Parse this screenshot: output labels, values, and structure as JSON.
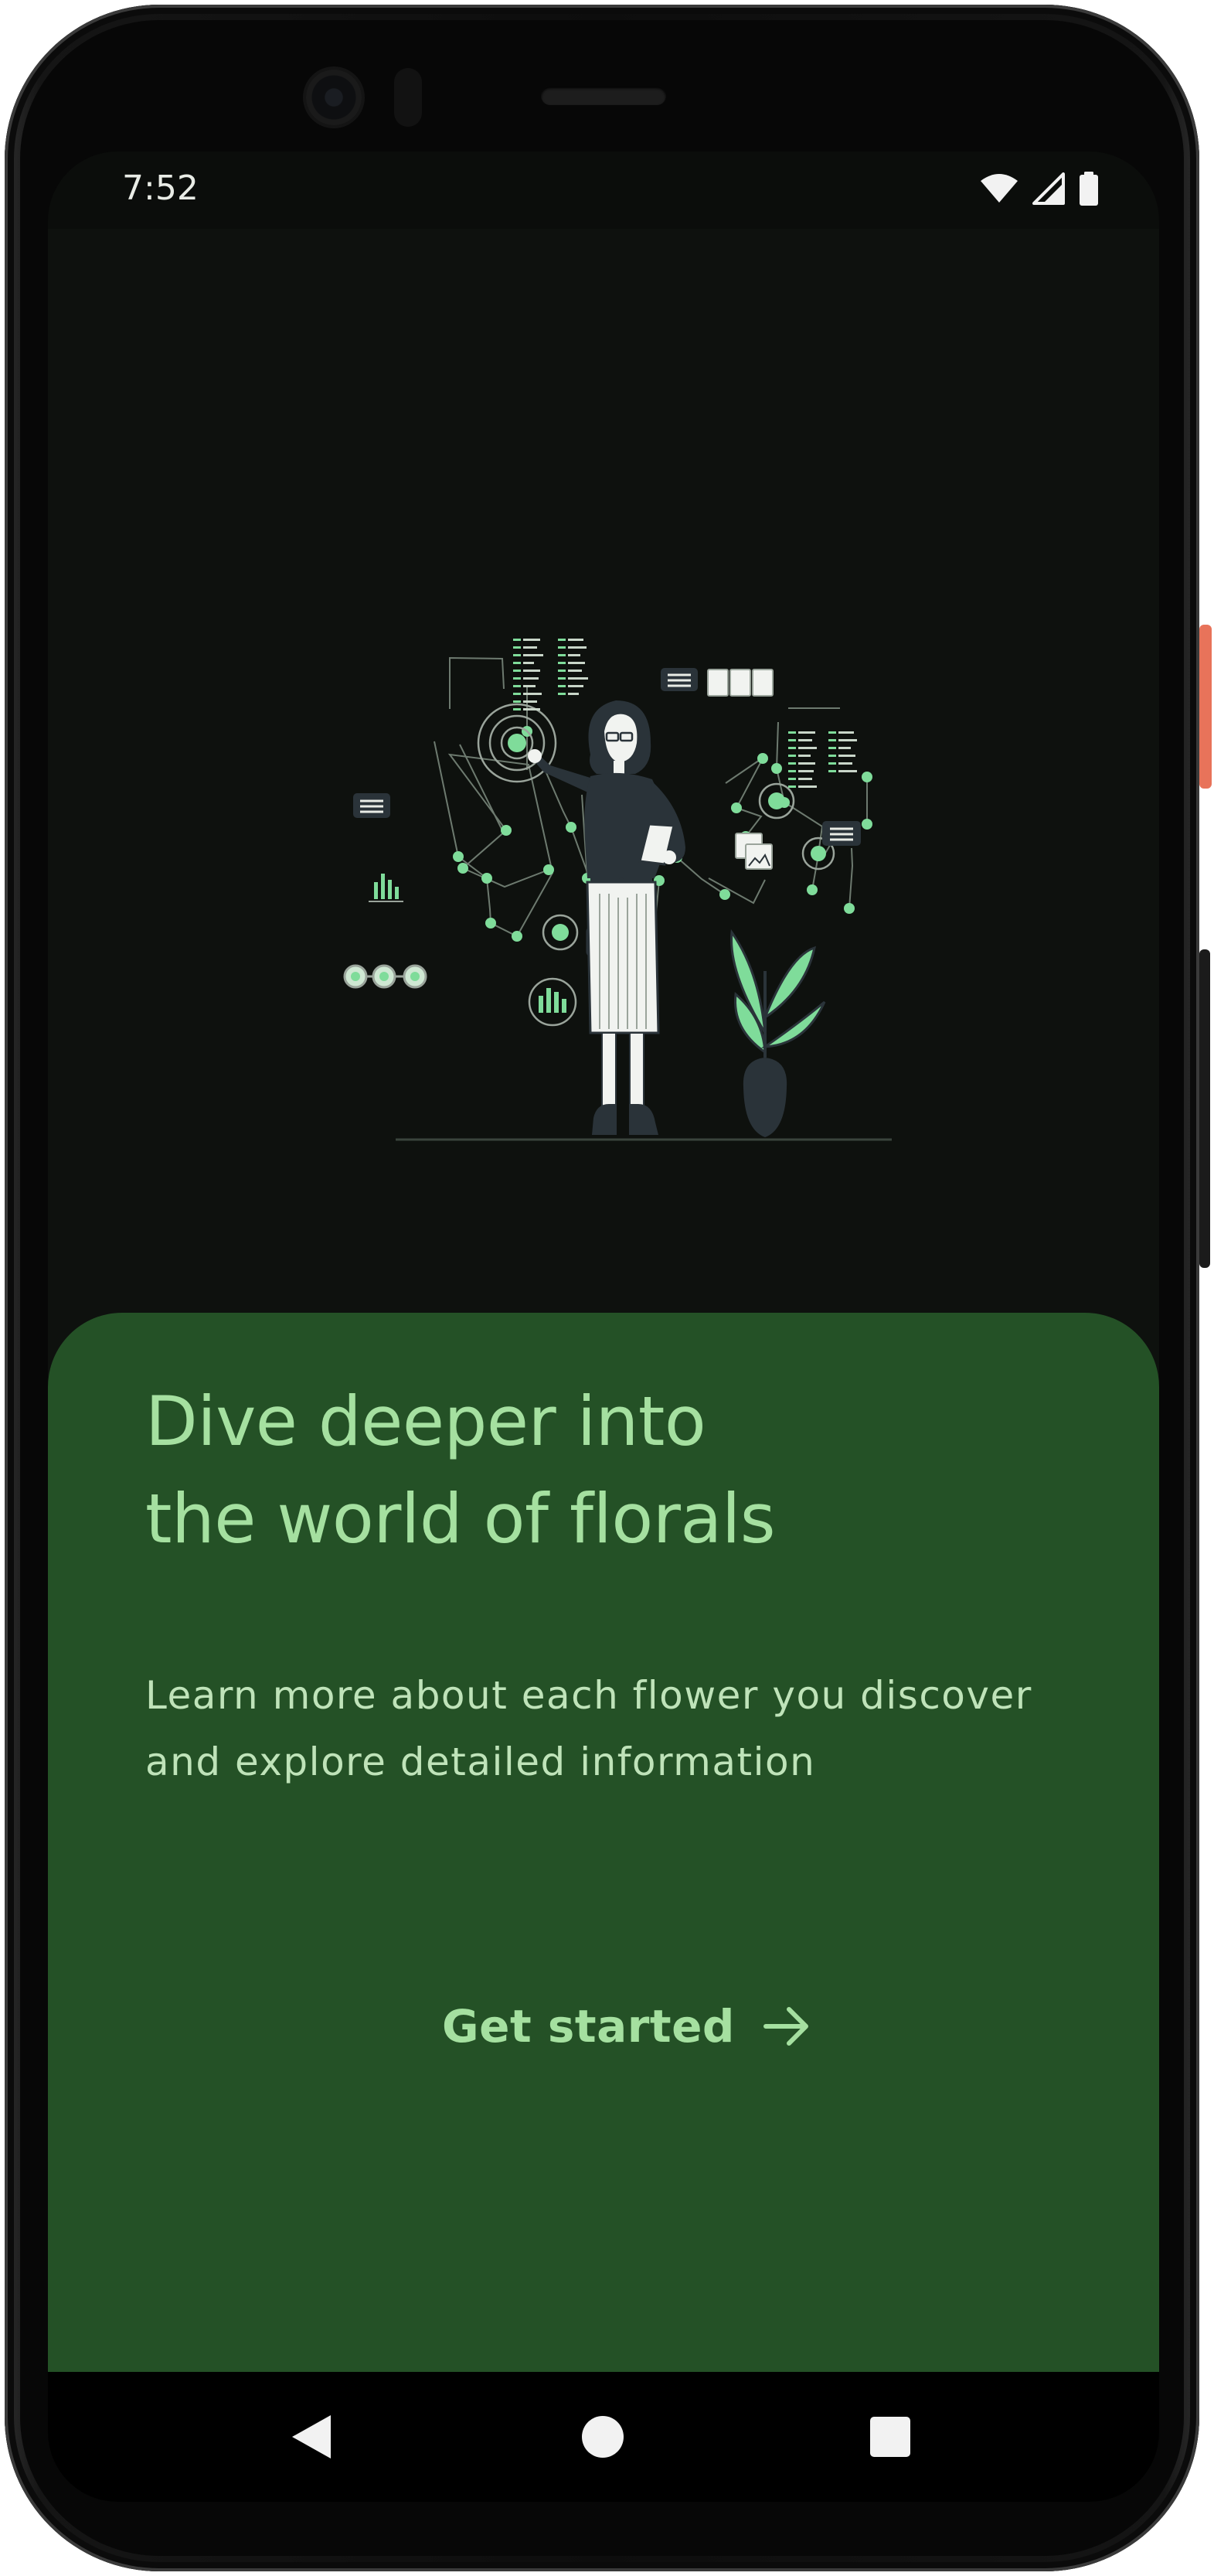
{
  "status_bar": {
    "time": "7:52",
    "icons": [
      "wifi-icon",
      "cell-signal-icon",
      "battery-icon"
    ]
  },
  "onboarding": {
    "illustration": "woman-network-data-illustration",
    "title_lines": [
      "Dive deeper into",
      "the world of florals"
    ],
    "body_lines": [
      "Learn more about each flower you discover",
      "and explore detailed information"
    ],
    "cta_label": "Get started",
    "cta_icon": "arrow-right-icon"
  },
  "navigation_bar": {
    "buttons": [
      "back-icon",
      "home-icon",
      "recents-icon"
    ]
  },
  "colors": {
    "background": "#0e110e",
    "sheet": "#245126",
    "accent_text": "#a5e0a0",
    "body_text": "#bfe3b9",
    "illustration_green": "#7fdc9a",
    "power_button": "#e8735a"
  }
}
